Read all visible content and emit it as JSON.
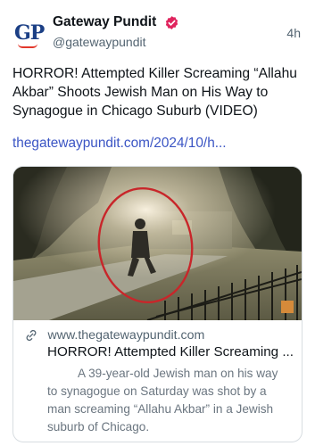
{
  "author": {
    "name": "Gateway Pundit",
    "handle": "@gatewaypundit",
    "avatar_text": "GP",
    "verified": true,
    "badge_color": "#e0245e"
  },
  "post": {
    "time": "4h",
    "text": "HORROR! Attempted Killer Screaming “Allahu Akbar” Shoots Jewish Man on His Way to Synagogue in Chicago Suburb (VIDEO)",
    "link": "thegatewaypundit.com/2024/10/h...",
    "link_color": "#3b55c4"
  },
  "card": {
    "domain": "www.thegatewaypundit.com",
    "title": "HORROR! Attempted Killer Screaming ...",
    "description": "A 39-year-old Jewish man on his way to synagogue on Saturday was shot by a man screaming “Allahu Akbar” in a Jewish suburb of Chicago.",
    "image_icon": "security-camera-still",
    "link_icon": "link-icon"
  }
}
